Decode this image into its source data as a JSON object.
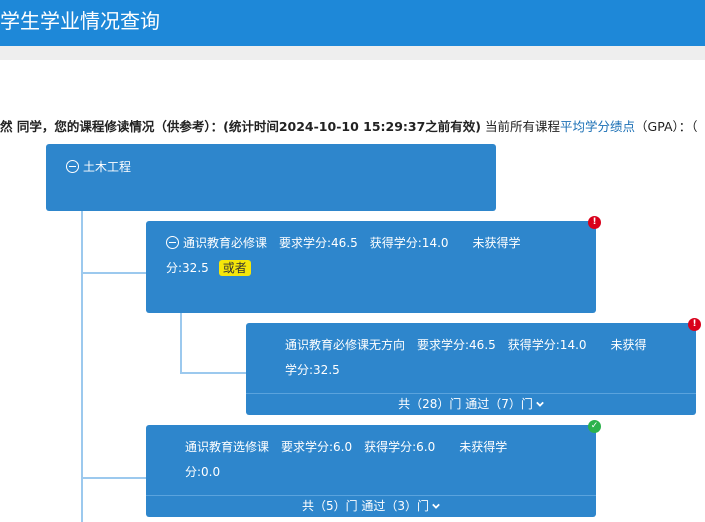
{
  "header": {
    "title": "学生学业情况查询"
  },
  "info": {
    "student_line": "然 同学，您的课程修读情况（供参考）：(统计时间2024-10-10 15:29:37之前有效)",
    "gpa_prefix": " 当前所有课程",
    "gpa_link": "平均学分绩点",
    "gpa_suffix": "（GPA）：",
    "trailing": "（"
  },
  "tree": {
    "root": {
      "label": "土木工程"
    },
    "nodes": [
      {
        "line1": "通识教育必修课　要求学分:46.5　获得学分:14.0　　未获得学",
        "line2": "分:32.5",
        "tag": "或者",
        "status": "error",
        "status_glyph": "!"
      },
      {
        "line1": "通识教育必修课无方向　要求学分:46.5　获得学分:14.0　　未获得",
        "line2": "学分:32.5",
        "footer": "共（28）门 通过（7）门",
        "status": "error",
        "status_glyph": "!"
      },
      {
        "line1": "通识教育选修课　要求学分:6.0　获得学分:6.0　　未获得学",
        "line2": "分:0.0",
        "footer": "共（5）门 通过（3）门",
        "status": "ok",
        "status_glyph": "✓"
      }
    ]
  },
  "colors": {
    "header_bg": "#1e88d8",
    "box_bg": "#2e86cc",
    "error": "#d9001b",
    "ok": "#2bb24c",
    "tag_bg": "#f5e60a"
  }
}
